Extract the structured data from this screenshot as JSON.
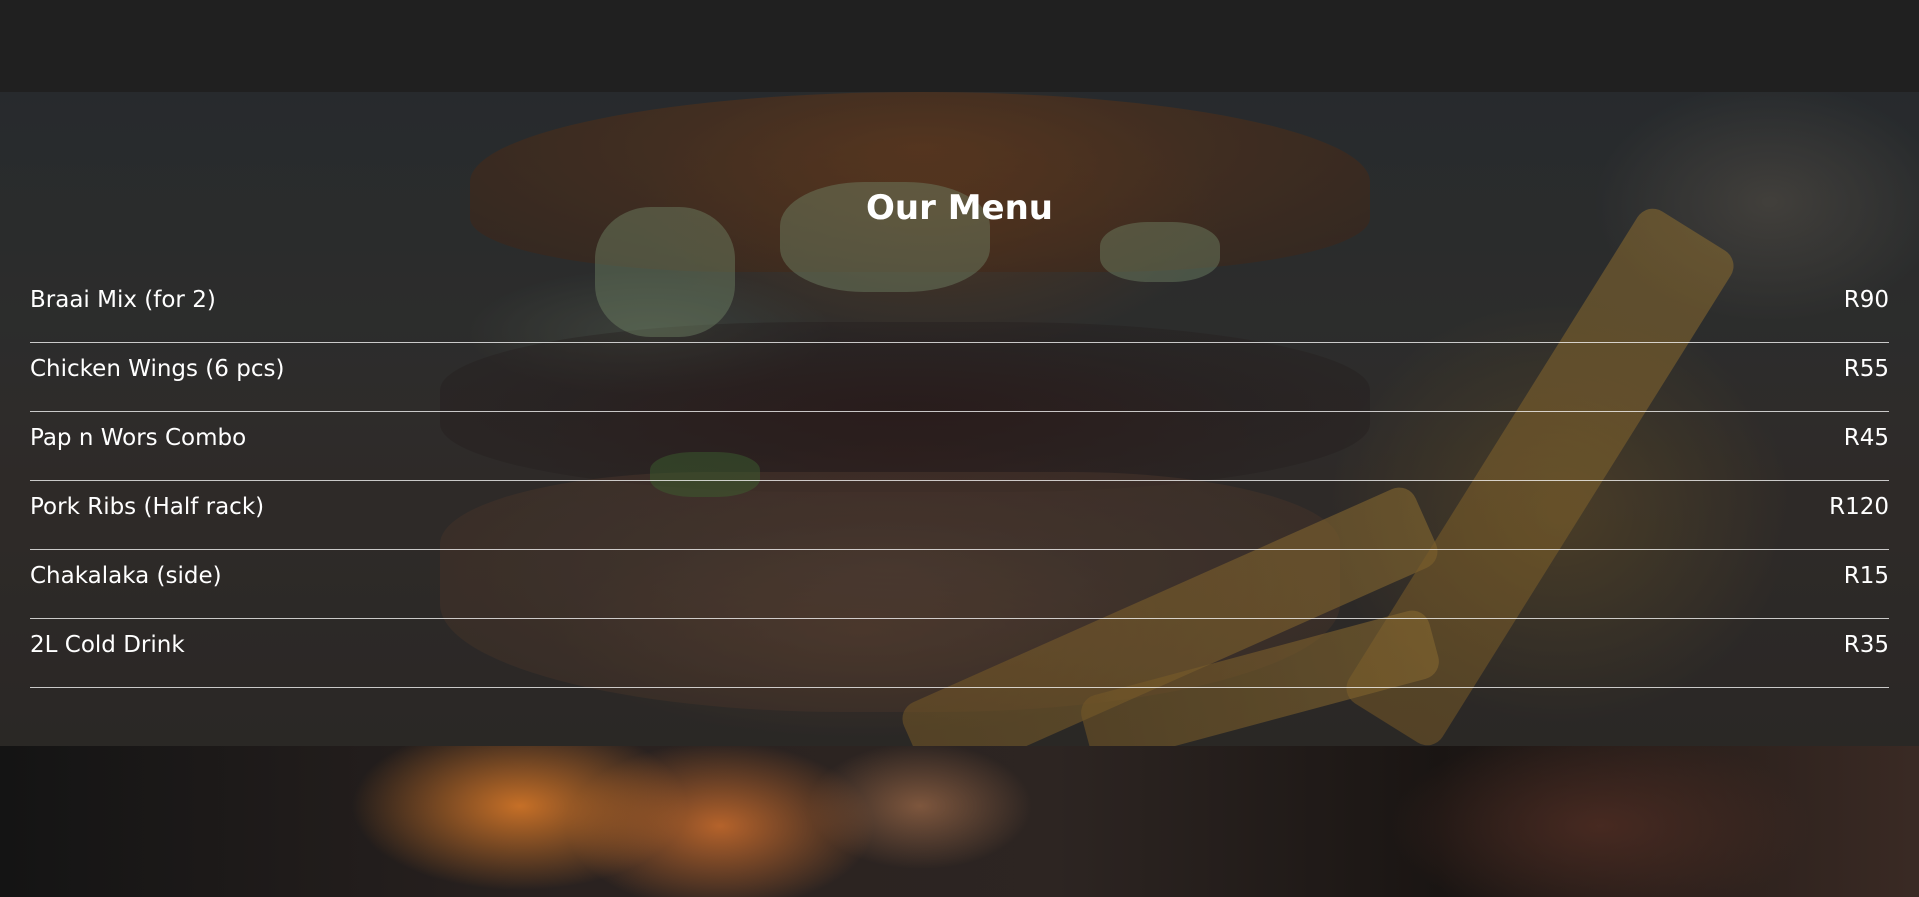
{
  "menu": {
    "title": "Our Menu",
    "items": [
      {
        "name": "Braai Mix (for 2)",
        "price": "R90"
      },
      {
        "name": "Chicken Wings (6 pcs)",
        "price": "R55"
      },
      {
        "name": "Pap n Wors Combo",
        "price": "R45"
      },
      {
        "name": "Pork Ribs (Half rack)",
        "price": "R120"
      },
      {
        "name": "Chakalaka (side)",
        "price": "R15"
      },
      {
        "name": "2L Cold Drink",
        "price": "R35"
      }
    ]
  },
  "colors": {
    "header_bar": "#202020",
    "text": "#ffffff",
    "divider": "#bfbfbf"
  }
}
